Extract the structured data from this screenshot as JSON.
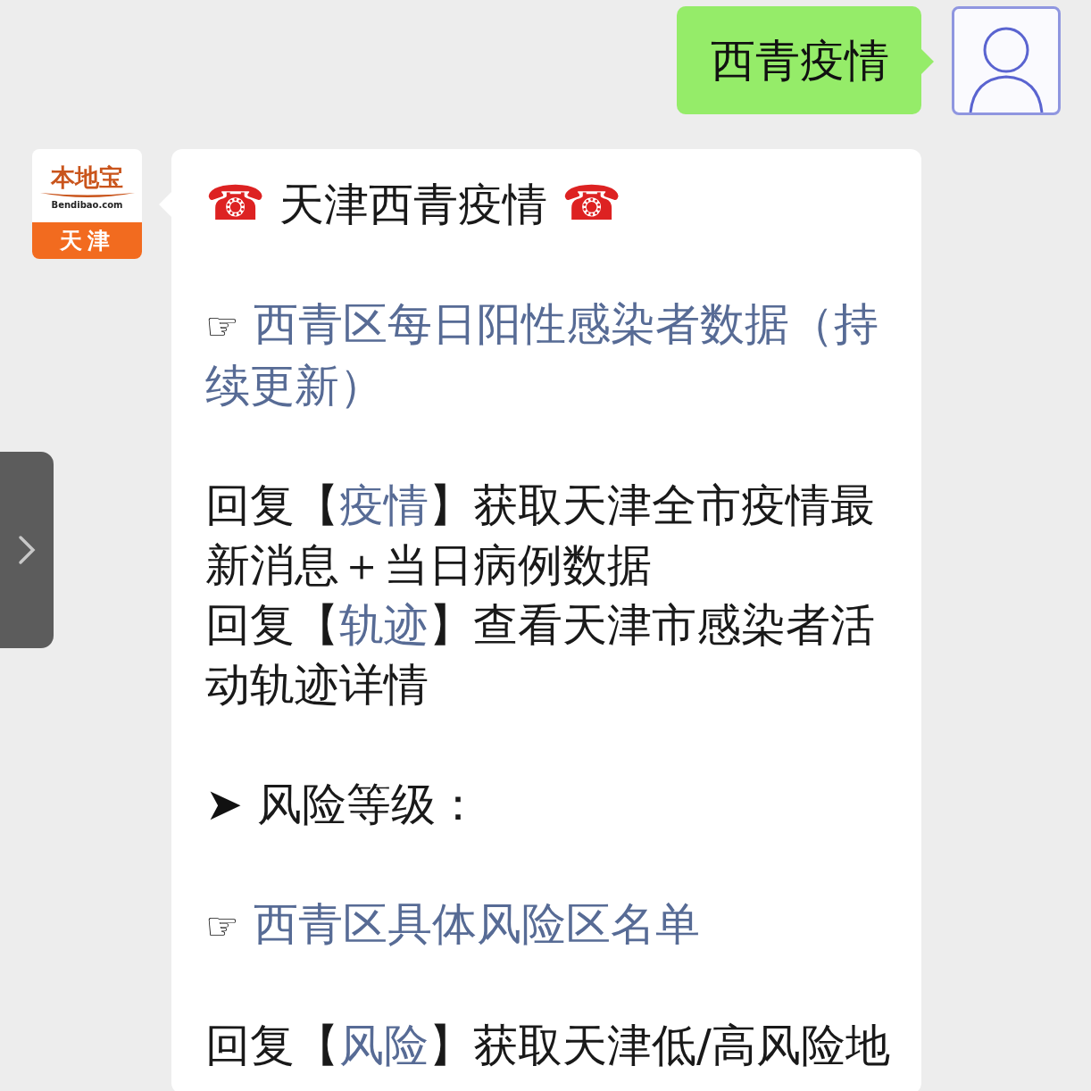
{
  "outgoing": {
    "text": "西青疫情"
  },
  "incoming": {
    "logo": {
      "name": "本地宝",
      "domain": "Bendibao.com",
      "city": "天津"
    },
    "sections": [
      [
        {
          "kind": "title",
          "lead": "☎",
          "text": "天津西青疫情",
          "trail": "☎"
        }
      ],
      [
        {
          "kind": "link",
          "lead": "☞",
          "text": "西青区每日阳性感染者数据（持续更新）"
        }
      ],
      [
        {
          "kind": "reply",
          "parts": [
            {
              "text": "回复【",
              "link": false
            },
            {
              "text": "疫情",
              "link": true
            },
            {
              "text": "】获取天津全市疫情最新消息＋当日病例数据",
              "link": false
            }
          ]
        },
        {
          "kind": "reply",
          "parts": [
            {
              "text": "回复【",
              "link": false
            },
            {
              "text": "轨迹",
              "link": true
            },
            {
              "text": "】查看天津市感染者活动轨迹详情",
              "link": false
            }
          ]
        }
      ],
      [
        {
          "kind": "heading",
          "lead": "➤",
          "text": "风险等级："
        }
      ],
      [
        {
          "kind": "link",
          "lead": "☞",
          "text": "西青区具体风险区名单"
        }
      ],
      [
        {
          "kind": "reply",
          "parts": [
            {
              "text": "回复【",
              "link": false
            },
            {
              "text": "风险",
              "link": true
            },
            {
              "text": "】获取天津低/高风险地",
              "link": false
            }
          ]
        }
      ]
    ]
  }
}
